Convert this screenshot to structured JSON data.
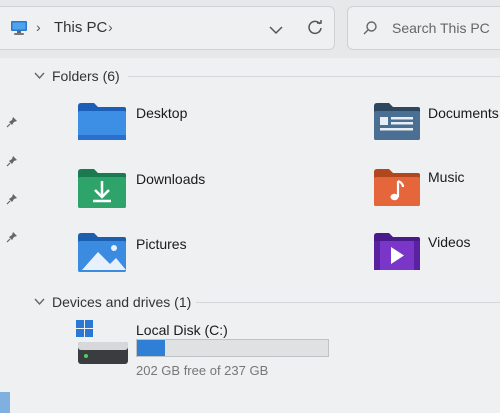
{
  "toolbar": {
    "breadcrumb": [
      "This PC"
    ],
    "search_placeholder": "Search This PC"
  },
  "sections": {
    "folders": {
      "title": "Folders (6)"
    },
    "devices": {
      "title": "Devices and drives (1)"
    }
  },
  "folders": [
    {
      "label": "Desktop",
      "icon": "desktop-folder-icon"
    },
    {
      "label": "Documents",
      "icon": "documents-folder-icon"
    },
    {
      "label": "Downloads",
      "icon": "downloads-folder-icon"
    },
    {
      "label": "Music",
      "icon": "music-folder-icon"
    },
    {
      "label": "Pictures",
      "icon": "pictures-folder-icon"
    },
    {
      "label": "Videos",
      "icon": "videos-folder-icon"
    }
  ],
  "drive": {
    "label": "Local Disk (C:)",
    "free_text": "202 GB free of 237 GB",
    "used_fraction": 0.148
  },
  "colors": {
    "accent": "#2f7fd6"
  }
}
